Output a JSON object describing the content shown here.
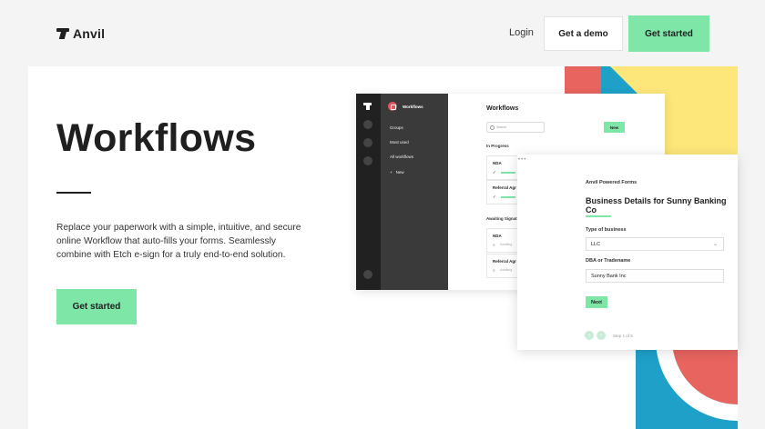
{
  "nav": {
    "brand": "Anvil",
    "login": "Login",
    "demo": "Get a demo",
    "get_started": "Get started"
  },
  "hero": {
    "title": "Workflows",
    "description": "Replace your paperwork with a simple, intuitive, and secure online Workflow that auto-fills your forms. Seamlessly combine with Etch e-sign for a truly end-to-end solution.",
    "cta": "Get started"
  },
  "app": {
    "sidebar_title": "Workflows",
    "sidebar_items": [
      "Groups",
      "Most used",
      "All workflows"
    ],
    "sidebar_new": "New",
    "main_title": "Workflows",
    "search_placeholder": "Search",
    "new_button": "New",
    "sections": [
      {
        "label": "In Progress",
        "items": [
          "NDA",
          "Referral Agr"
        ]
      },
      {
        "label": "Awaiting Signat",
        "items": [
          "NDA",
          "Referral Agr"
        ]
      }
    ],
    "awaiting_sub": "Awaiting"
  },
  "form": {
    "brand": "Anvil Powered Forms",
    "title": "Business Details for Sunny Banking Co",
    "type_label": "Type of business",
    "type_value": "LLC",
    "dba_label": "DBA or Tradename",
    "dba_value": "Sunny Bank Inc",
    "next": "Next",
    "step": "Step 1 of 5"
  },
  "colors": {
    "accent_green": "#7ee7a8",
    "coral": "#e8645f",
    "yellow": "#fde77a",
    "blue": "#1ea0c9",
    "dark": "#1f1f1f"
  }
}
